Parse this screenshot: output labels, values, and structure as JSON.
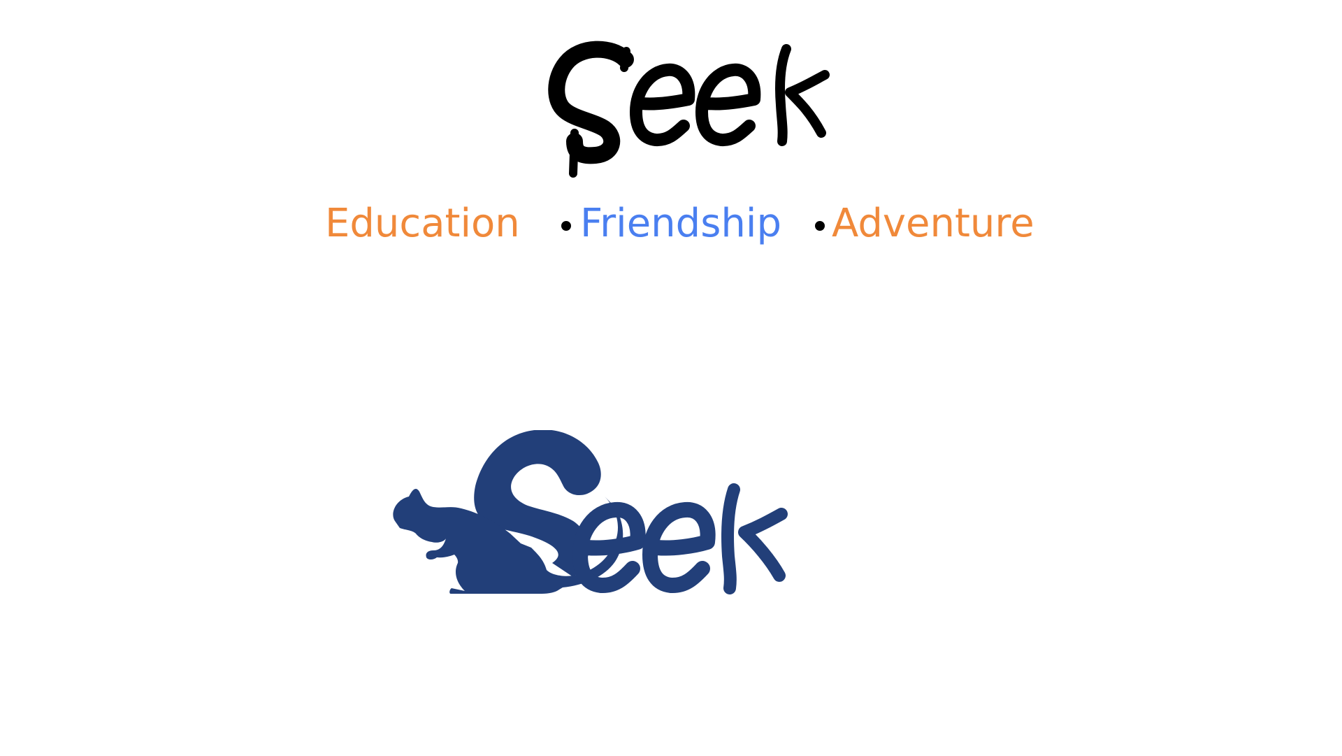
{
  "logo_top": {
    "text": "Seek",
    "color": "#000000"
  },
  "tagline": {
    "words": [
      {
        "text": "Education",
        "color": "#f0893a"
      },
      {
        "text": "Friendship",
        "color": "#4a7ff0"
      },
      {
        "text": "Adventure",
        "color": "#f0893a"
      }
    ],
    "separator_color": "#000000"
  },
  "logo_bottom": {
    "text": "Seek",
    "color": "#223f79",
    "icon": "squirrel-icon"
  }
}
